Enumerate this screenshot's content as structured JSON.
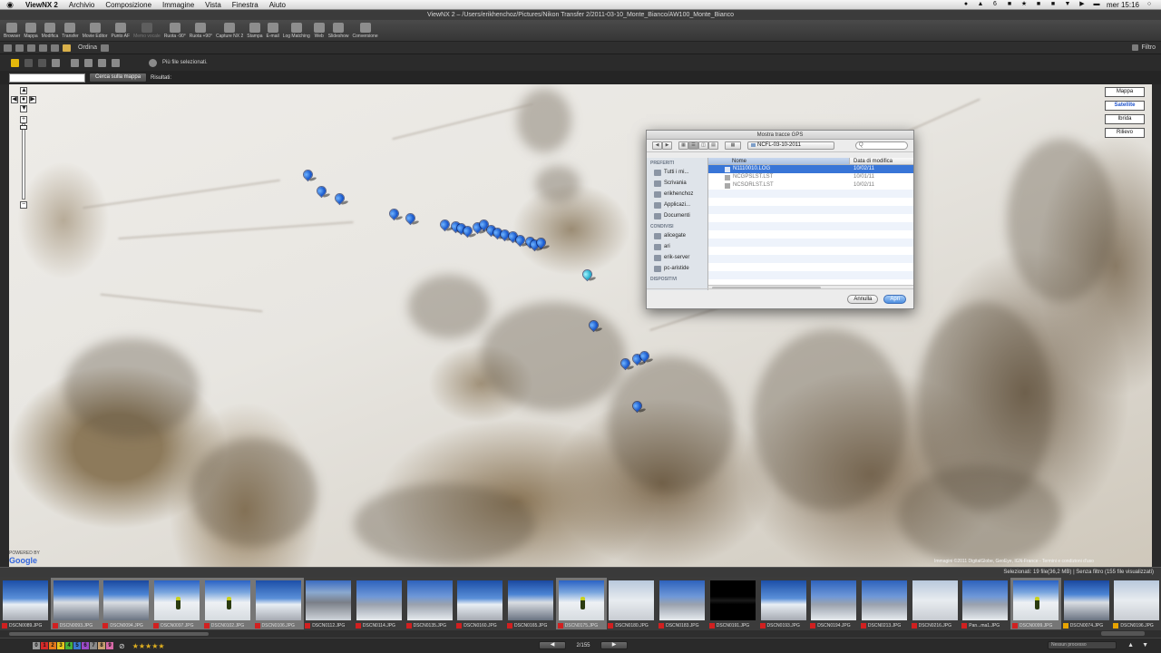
{
  "menubar": {
    "apple": "",
    "app": "ViewNX 2",
    "items": [
      "Archivio",
      "Composizione",
      "Immagine",
      "Vista",
      "Finestra",
      "Aiuto"
    ],
    "right": {
      "badge": "6",
      "time": "mer 15:16"
    }
  },
  "window": {
    "title": "ViewNX 2 – /Users/erikhenchoz/Pictures/Nikon Transfer 2/2011-03-10_Monte_Bianco/AW100_Monte_Bianco"
  },
  "toolbar": {
    "buttons": [
      {
        "label": "Browser",
        "enabled": true
      },
      {
        "label": "Mappa",
        "enabled": true
      },
      {
        "label": "Modifica",
        "enabled": true
      },
      {
        "label": "Transfer",
        "enabled": true
      },
      {
        "label": "Movie Editor",
        "enabled": true
      },
      {
        "label": "Punto AF",
        "enabled": true
      },
      {
        "label": "Memo vocale",
        "enabled": false
      },
      {
        "label": "Ruota -90°",
        "enabled": true
      },
      {
        "label": "Ruota +90°",
        "enabled": true
      },
      {
        "label": "Capture NX 2",
        "enabled": true
      },
      {
        "label": "Stampa",
        "enabled": true
      },
      {
        "label": "E-mail",
        "enabled": true
      },
      {
        "label": "Log Matching",
        "enabled": true
      },
      {
        "label": "Web",
        "enabled": true
      },
      {
        "label": "Slideshow",
        "enabled": true
      },
      {
        "label": "Conversione",
        "enabled": true
      }
    ]
  },
  "toolbar2": {
    "sort_label": "Ordina",
    "filter_label": "Filtro"
  },
  "maptools": {
    "status": "Più file selezionati."
  },
  "search": {
    "input_value": "",
    "button_label": "Cerca sulla mappa",
    "results_label": "Risultati:"
  },
  "map": {
    "types": [
      {
        "label": "Mappa",
        "active": false
      },
      {
        "label": "Satellite",
        "active": true
      },
      {
        "label": "Ibrida",
        "active": false
      },
      {
        "label": "Rilievo",
        "active": false
      }
    ],
    "attribution": "POWERED BY",
    "logo": "Google",
    "copyright": "Immagini ©2011 DigitalGlobe, GeoEye, IGN-France - Termini e condizioni d'uso",
    "pins": [
      {
        "lat": 0.178,
        "lng": 0.258,
        "cyan": false
      },
      {
        "lat": 0.213,
        "lng": 0.27,
        "cyan": false
      },
      {
        "lat": 0.228,
        "lng": 0.286,
        "cyan": false
      },
      {
        "lat": 0.26,
        "lng": 0.333,
        "cyan": false
      },
      {
        "lat": 0.268,
        "lng": 0.348,
        "cyan": false
      },
      {
        "lat": 0.282,
        "lng": 0.378,
        "cyan": false
      },
      {
        "lat": 0.286,
        "lng": 0.387,
        "cyan": false
      },
      {
        "lat": 0.29,
        "lng": 0.392,
        "cyan": false
      },
      {
        "lat": 0.296,
        "lng": 0.398,
        "cyan": false
      },
      {
        "lat": 0.288,
        "lng": 0.406,
        "cyan": false
      },
      {
        "lat": 0.282,
        "lng": 0.412,
        "cyan": false
      },
      {
        "lat": 0.294,
        "lng": 0.418,
        "cyan": false
      },
      {
        "lat": 0.298,
        "lng": 0.424,
        "cyan": false
      },
      {
        "lat": 0.302,
        "lng": 0.43,
        "cyan": false
      },
      {
        "lat": 0.306,
        "lng": 0.437,
        "cyan": false
      },
      {
        "lat": 0.314,
        "lng": 0.444,
        "cyan": false
      },
      {
        "lat": 0.318,
        "lng": 0.452,
        "cyan": false
      },
      {
        "lat": 0.324,
        "lng": 0.456,
        "cyan": false
      },
      {
        "lat": 0.32,
        "lng": 0.462,
        "cyan": false
      },
      {
        "lat": 0.386,
        "lng": 0.502,
        "cyan": true
      },
      {
        "lat": 0.491,
        "lng": 0.508,
        "cyan": false
      },
      {
        "lat": 0.57,
        "lng": 0.536,
        "cyan": false
      },
      {
        "lat": 0.56,
        "lng": 0.546,
        "cyan": false
      },
      {
        "lat": 0.554,
        "lng": 0.552,
        "cyan": false
      },
      {
        "lat": 0.658,
        "lng": 0.546,
        "cyan": false
      }
    ]
  },
  "dialog": {
    "title": "Mostra tracce GPS",
    "folder": "NCFL-03-10-2011",
    "search_placeholder": "Q",
    "sidebar": [
      {
        "heading": "PREFERITI",
        "items": [
          "Tutti i mi...",
          "Scrivania",
          "erikhenchoz",
          "Applicazi...",
          "Documenti"
        ]
      },
      {
        "heading": "CONDIVISI",
        "items": [
          "alicegate",
          "ari",
          "erik-server",
          "pc-aristide"
        ]
      },
      {
        "heading": "DISPOSITIVI",
        "items": []
      }
    ],
    "columns": {
      "name": "Nome",
      "date": "Data di modifica"
    },
    "files": [
      {
        "name": "N1110010.LOG",
        "date": "10/02/11",
        "selected": true,
        "enabled": true
      },
      {
        "name": "NCGPSLST.LST",
        "date": "10/01/11",
        "selected": false,
        "enabled": false
      },
      {
        "name": "NCSORLST.LST",
        "date": "10/02/11",
        "selected": false,
        "enabled": false
      }
    ],
    "cancel_label": "Annulla",
    "open_label": "Apri"
  },
  "filmstrip": {
    "status": "Selezionati: 19 file(36,2 MB) | Senza filtro (155 file visualizzati)",
    "thumbs": [
      {
        "name": "DSCN0089.JPG",
        "scene": "sky",
        "selected": false
      },
      {
        "name": "DSCN0093.JPG",
        "scene": "peak",
        "selected": true
      },
      {
        "name": "DSCN0094.JPG",
        "scene": "peak",
        "selected": true
      },
      {
        "name": "DSCN0097.JPG",
        "scene": "person",
        "selected": true
      },
      {
        "name": "DSCN0102.JPG",
        "scene": "person",
        "selected": true
      },
      {
        "name": "DSCN0106.JPG",
        "scene": "sky",
        "selected": true
      },
      {
        "name": "DSCN0112.JPG",
        "scene": "rock",
        "selected": false
      },
      {
        "name": "DSCN0114.JPG",
        "scene": "ridge",
        "selected": false
      },
      {
        "name": "DSCN0135.JPG",
        "scene": "ridge",
        "selected": false
      },
      {
        "name": "DSCN0160.JPG",
        "scene": "sky",
        "selected": false
      },
      {
        "name": "DSCN0165.JPG",
        "scene": "peak",
        "selected": false
      },
      {
        "name": "DSCN0175.JPG",
        "scene": "person",
        "selected": true
      },
      {
        "name": "DSCN0180.JPG",
        "scene": "snow",
        "selected": false
      },
      {
        "name": "DSCN0183.JPG",
        "scene": "ridge",
        "selected": false
      },
      {
        "name": "DSCN0191.JPG",
        "scene": "dark",
        "selected": false
      },
      {
        "name": "DSCN0193.JPG",
        "scene": "sky",
        "selected": false
      },
      {
        "name": "DSCN0194.JPG",
        "scene": "ridge",
        "selected": false
      },
      {
        "name": "DSCN0213.JPG",
        "scene": "ridge",
        "selected": false
      },
      {
        "name": "DSCN0216.JPG",
        "scene": "snow",
        "selected": false
      },
      {
        "name": "Pan...ma1.JPG",
        "scene": "ridge",
        "selected": false
      },
      {
        "name": "DSCN0099.JPG",
        "scene": "person",
        "selected": true
      },
      {
        "name": "DSCN0074.JPG",
        "scene": "peak",
        "selected": false,
        "last": true
      },
      {
        "name": "DSCN0196.JPG",
        "scene": "snow",
        "selected": false,
        "last": true
      }
    ]
  },
  "bottom": {
    "labels": [
      {
        "text": "0",
        "color": "#9a9a9a"
      },
      {
        "text": "1",
        "color": "#d42a2a"
      },
      {
        "text": "2",
        "color": "#e67a1c"
      },
      {
        "text": "3",
        "color": "#e6c81c"
      },
      {
        "text": "4",
        "color": "#46b23a"
      },
      {
        "text": "5",
        "color": "#3a78d0"
      },
      {
        "text": "6",
        "color": "#9b4ac9"
      },
      {
        "text": "7",
        "color": "#8a8a8a"
      },
      {
        "text": "8",
        "color": "#c8a070"
      },
      {
        "text": "9",
        "color": "#d86aa8"
      }
    ],
    "stars": "★★★★★",
    "prev": "◀",
    "page": "2/155",
    "next": "▶",
    "process": "Nessun processo"
  }
}
